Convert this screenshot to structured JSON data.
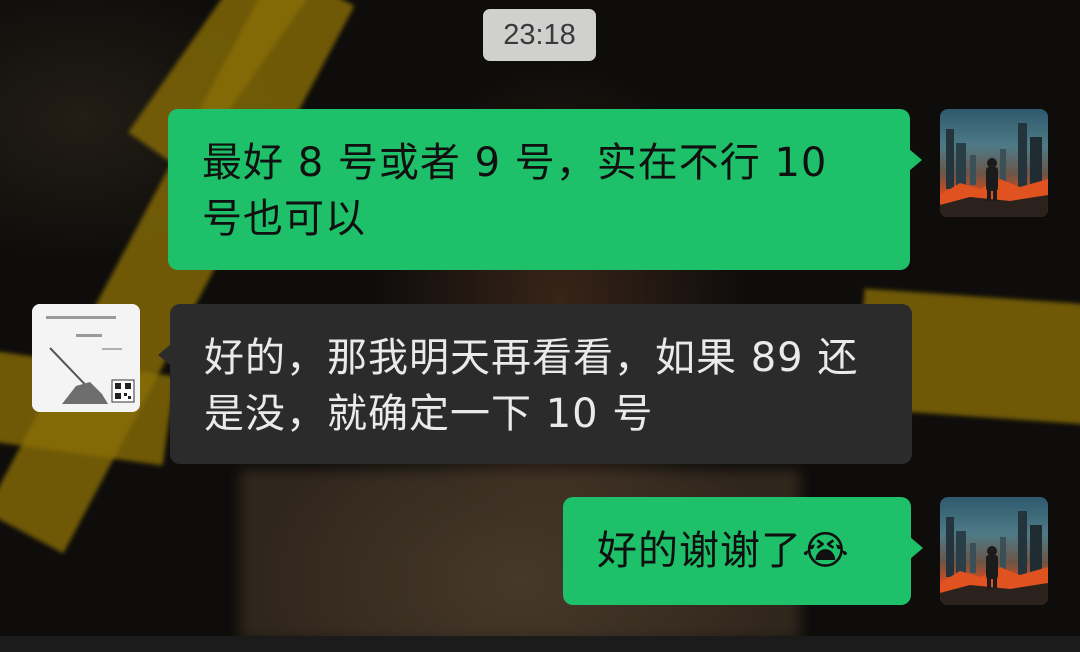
{
  "timestamp": "23:18",
  "messages": [
    {
      "sender": "me",
      "text": "最好 8 号或者 9 号，实在不行 10 号也可以",
      "avatar_icon": "cityscape-person-avatar"
    },
    {
      "sender": "other",
      "text": "好的，那我明天再看看，如果 89 还是没，就确定一下 10 号",
      "avatar_icon": "book-cover-avatar"
    },
    {
      "sender": "me",
      "text": "好的谢谢了",
      "emoji": "😭",
      "avatar_icon": "cityscape-person-avatar"
    }
  ],
  "colors": {
    "my_bubble": "#1ec169",
    "their_bubble": "#2b2b2b",
    "time_pill": "#e1e1e1"
  }
}
